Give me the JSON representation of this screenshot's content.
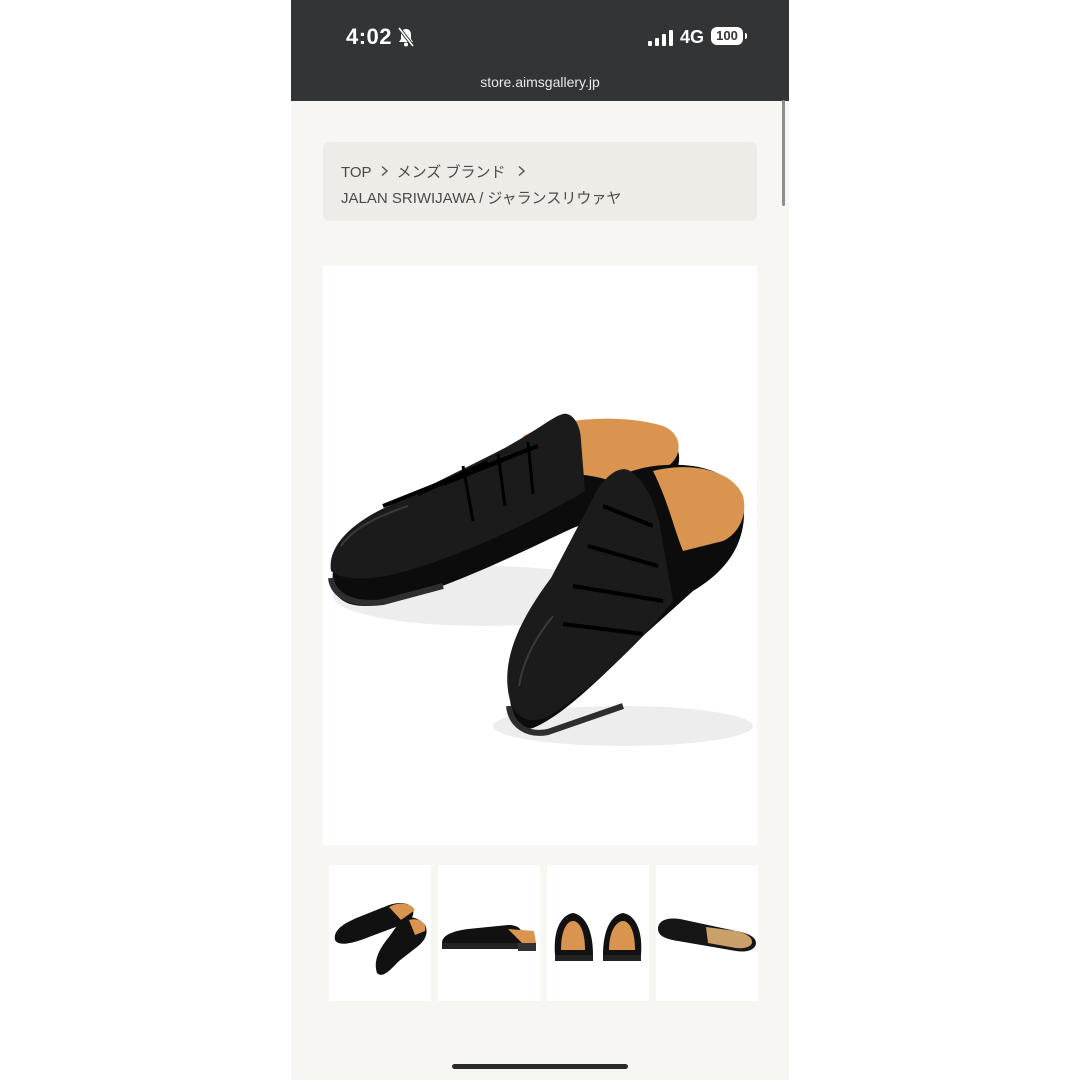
{
  "status_bar": {
    "time": "4:02",
    "network": "4G",
    "battery": "100",
    "icons": [
      "bell-slash-icon",
      "signal-icon",
      "battery-icon"
    ]
  },
  "browser": {
    "url": "store.aimsgallery.jp"
  },
  "breadcrumb": {
    "items": [
      "TOP",
      "メンズ ブランド",
      "JALAN SRIWIJAWA / ジャランスリウァヤ"
    ],
    "separator_icon": "chevron-right-icon"
  },
  "product": {
    "main_image": "black-leather-gurkha-sandal-slippers",
    "thumbnails": [
      "pair-angled-view",
      "side-view",
      "back-view",
      "sole-view"
    ]
  },
  "colors": {
    "status_bar": "#323436",
    "page_background": "#f7f6f3",
    "breadcrumb_background": "#eeece6",
    "leather": "#141414",
    "insole": "#d9944f"
  }
}
